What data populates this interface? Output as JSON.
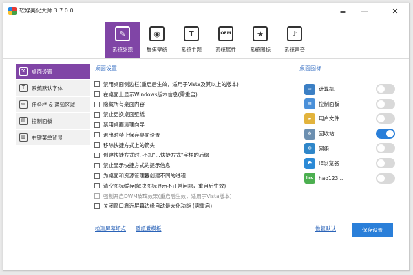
{
  "window": {
    "title": "软媒美化大师 3.7.0.0"
  },
  "titlebar_icons": {
    "menu": "hamburger-icon",
    "minimize": "minimize-icon",
    "close": "close-icon"
  },
  "toolbar": {
    "active_color": "#8045a6",
    "tabs": [
      {
        "label": "系统外观",
        "icon": "brush-icon",
        "active": true
      },
      {
        "label": "聚焦壁纸",
        "icon": "target-icon",
        "active": false
      },
      {
        "label": "系统主题",
        "icon": "shirt-icon",
        "active": false
      },
      {
        "label": "系统属性",
        "icon": "oem-icon",
        "active": false
      },
      {
        "label": "系统图标",
        "icon": "star-icon",
        "active": false
      },
      {
        "label": "系统声音",
        "icon": "speaker-icon",
        "active": false
      }
    ]
  },
  "sidebar": {
    "items": [
      {
        "label": "桌面设置",
        "icon": "wrench-icon",
        "active": true
      },
      {
        "label": "系统默认字体",
        "icon": "font-icon",
        "active": false
      },
      {
        "label": "任务栏 & 通知区域",
        "icon": "taskbar-icon",
        "active": false
      },
      {
        "label": "控制面板",
        "icon": "control-panel-icon",
        "active": false
      },
      {
        "label": "右键菜单背景",
        "icon": "context-menu-icon",
        "active": false
      }
    ]
  },
  "desktop_settings": {
    "title": "桌面设置",
    "options": [
      {
        "label": "禁用桌面侧边栏(重启后生效，适用于Vista及其以上的版本)",
        "checked": false,
        "disabled": false
      },
      {
        "label": "在桌面上显示Windows版本信息(需重启)",
        "checked": false,
        "disabled": false
      },
      {
        "label": "隐藏所有桌面内容",
        "checked": false,
        "disabled": false
      },
      {
        "label": "禁止更换桌面壁纸",
        "checked": false,
        "disabled": false
      },
      {
        "label": "禁用桌面清理向导",
        "checked": false,
        "disabled": false
      },
      {
        "label": "退出时禁止保存桌面设置",
        "checked": false,
        "disabled": false
      },
      {
        "label": "移除快捷方式上的箭头",
        "checked": false,
        "disabled": false
      },
      {
        "label": "创建快捷方式时, 不加\"...快捷方式\"字样的后缀",
        "checked": false,
        "disabled": false
      },
      {
        "label": "禁止显示快捷方式的提示信息",
        "checked": false,
        "disabled": false
      },
      {
        "label": "为桌面和资源管理器创建不同的进程",
        "checked": false,
        "disabled": false
      },
      {
        "label": "清空图标缓存(解决图标显示不正常问题，重启后生效)",
        "checked": false,
        "disabled": false
      },
      {
        "label": "强制开启DWM玻璃效果(重启后生效，适用于Vista版本)",
        "checked": false,
        "disabled": true
      },
      {
        "label": "关闭窗口靠近屏幕边缘自动最大化功能 (需重启)",
        "checked": false,
        "disabled": false
      }
    ]
  },
  "desktop_icons": {
    "title": "桌面图标",
    "items": [
      {
        "label": "计算机",
        "icon": "computer-icon",
        "color": "#3b7fc4",
        "enabled": false
      },
      {
        "label": "控制面板",
        "icon": "control-panel-icon",
        "color": "#4a90d9",
        "enabled": false
      },
      {
        "label": "用户文件",
        "icon": "user-folder-icon",
        "color": "#e2b33c",
        "enabled": false
      },
      {
        "label": "回收站",
        "icon": "recycle-bin-icon",
        "color": "#6c8fb0",
        "enabled": true
      },
      {
        "label": "网络",
        "icon": "network-icon",
        "color": "#2e86c9",
        "enabled": false
      },
      {
        "label": "IE浏览器",
        "icon": "ie-icon",
        "color": "#2c8ad6",
        "enabled": false
      },
      {
        "label": "hao123...",
        "icon": "hao123-icon",
        "color": "#4caf50",
        "enabled": false
      }
    ]
  },
  "footer": {
    "link_left_1": "检测屏幕坏点",
    "link_left_2": "壁纸爱模板",
    "restore_default": "恢复默认",
    "save": "保存设置"
  }
}
